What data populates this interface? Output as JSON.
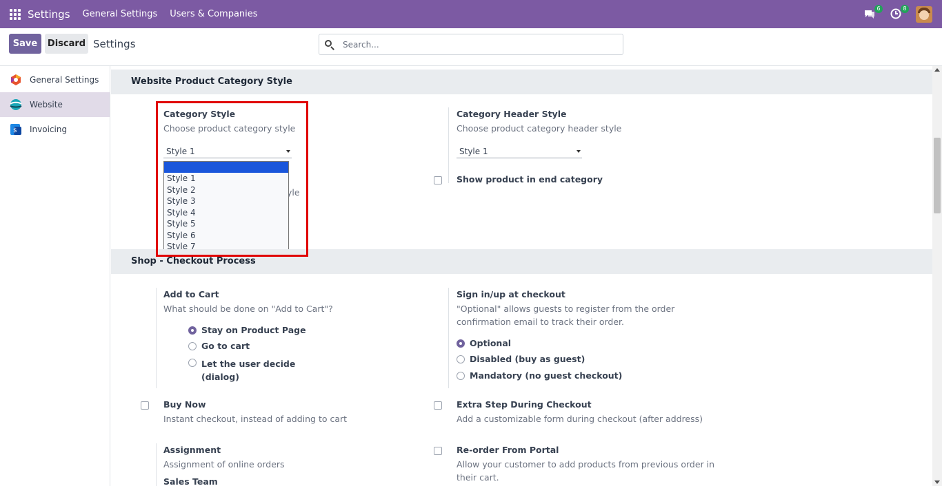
{
  "navbar": {
    "brand": "Settings",
    "links": [
      "General Settings",
      "Users & Companies"
    ],
    "messages_count": "6",
    "activities_count": "8",
    "bg_color": "#7c5aa3"
  },
  "control_panel": {
    "save_label": "Save",
    "discard_label": "Discard",
    "title": "Settings",
    "search_placeholder": "Search..."
  },
  "sidebar": {
    "items": [
      {
        "label": "General Settings",
        "icon": "odoo-settings-icon",
        "active": false
      },
      {
        "label": "Website",
        "icon": "website-icon",
        "active": true
      },
      {
        "label": "Invoicing",
        "icon": "invoicing-icon",
        "active": false
      }
    ]
  },
  "sections": {
    "category_style": {
      "header": "Website Product Category Style",
      "category_style": {
        "title": "Category Style",
        "desc": "Choose product category style",
        "value": "Style 1",
        "options": [
          "",
          "Style 1",
          "Style 2",
          "Style 3",
          "Style 4",
          "Style 5",
          "Style 6",
          "Style 7"
        ]
      },
      "hidden_fragment": "yle",
      "header_style": {
        "title": "Category Header Style",
        "desc": "Choose product category header style",
        "value": "Style 1"
      },
      "show_end_category": "Show product in end category"
    },
    "checkout": {
      "header": "Shop - Checkout Process",
      "add_to_cart": {
        "title": "Add to Cart",
        "desc": "What should be done on \"Add to Cart\"?",
        "options": [
          "Stay on Product Page",
          "Go to cart",
          "Let the user decide",
          "(dialog)"
        ],
        "selected": "Stay on Product Page"
      },
      "sign_in": {
        "title": "Sign in/up at checkout",
        "desc1": "\"Optional\" allows guests to register from the order",
        "desc2": "confirmation email to track their order.",
        "options": [
          "Optional",
          "Disabled (buy as guest)",
          "Mandatory (no guest checkout)"
        ],
        "selected": "Optional"
      },
      "buy_now": {
        "title": "Buy Now",
        "desc": "Instant checkout, instead of adding to cart"
      },
      "extra_step": {
        "title": "Extra Step During Checkout",
        "desc": "Add a customizable form during checkout (after address)"
      },
      "assignment": {
        "title": "Assignment",
        "desc": "Assignment of online orders",
        "partial": "Sales Team"
      },
      "reorder": {
        "title": "Re-order From Portal",
        "desc1": "Allow your customer to add products from previous order in",
        "desc2": "their cart."
      }
    }
  }
}
